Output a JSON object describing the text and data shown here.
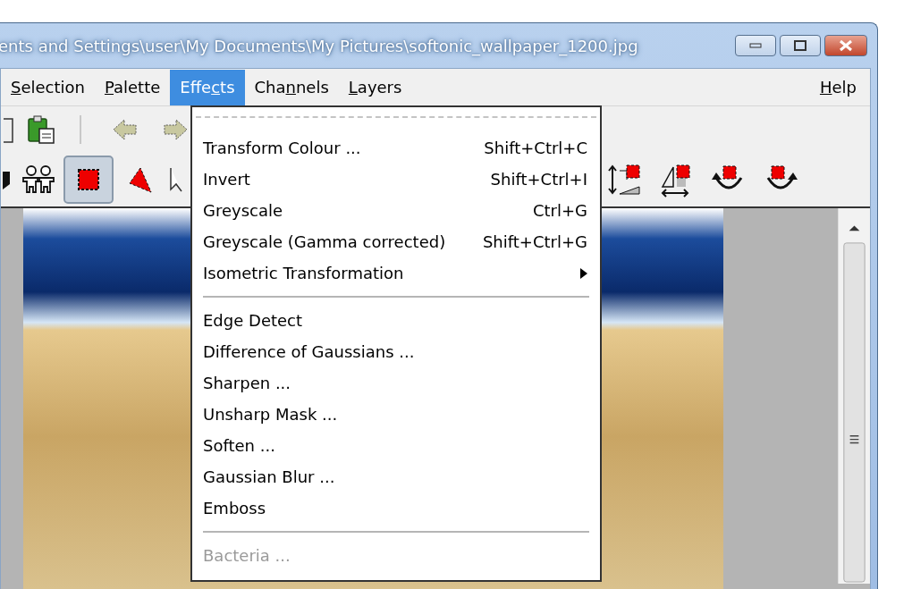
{
  "window": {
    "title": "ents and Settings\\user\\My Documents\\My Pictures\\softonic_wallpaper_1200.jpg"
  },
  "menu_bar": [
    {
      "label": {
        "key": "S",
        "after": "election"
      },
      "selected": false
    },
    {
      "label": {
        "key": "P",
        "after": "alette"
      },
      "selected": false
    },
    {
      "label": {
        "before": "Effe",
        "key": "c",
        "after": "ts"
      },
      "selected": true
    },
    {
      "label": {
        "before": "Cha",
        "key": "n",
        "after": "nels"
      },
      "selected": false
    },
    {
      "label": {
        "key": "L",
        "after": "ayers"
      },
      "selected": false
    }
  ],
  "help_menu": {
    "label": {
      "key": "H",
      "after": "elp"
    },
    "selected": false
  },
  "toolbar_top": [
    {
      "kind": "document"
    },
    {
      "kind": "paste"
    },
    {
      "kind": "separator"
    },
    {
      "kind": "back"
    },
    {
      "kind": "forward"
    }
  ],
  "toolbar_bottom": [
    {
      "kind": "shape",
      "selected": false
    },
    {
      "kind": "people",
      "selected": false
    },
    {
      "kind": "rect-select",
      "selected": true
    },
    {
      "kind": "lasso",
      "selected": false
    },
    {
      "kind": "pointer",
      "selected": false
    }
  ],
  "toolbar_right": [
    {
      "kind": "flip-vertical"
    },
    {
      "kind": "flip-horizontal"
    },
    {
      "kind": "rotate-left"
    },
    {
      "kind": "rotate-right"
    }
  ],
  "effects_menu": [
    {
      "kind": "tearoff"
    },
    {
      "kind": "item",
      "label": "Transform Colour ...",
      "shortcut": "Shift+Ctrl+C",
      "disabled": false
    },
    {
      "kind": "item",
      "label": "Invert",
      "shortcut": "Shift+Ctrl+I",
      "disabled": false
    },
    {
      "kind": "item",
      "label": "Greyscale",
      "shortcut": "Ctrl+G",
      "disabled": false
    },
    {
      "kind": "item",
      "label": "Greyscale (Gamma corrected)",
      "shortcut": "Shift+Ctrl+G",
      "disabled": false
    },
    {
      "kind": "submenu",
      "label": "Isometric Transformation",
      "disabled": false
    },
    {
      "kind": "separator"
    },
    {
      "kind": "item",
      "label": "Edge Detect",
      "disabled": false
    },
    {
      "kind": "item",
      "label": "Difference of Gaussians ...",
      "disabled": false
    },
    {
      "kind": "item",
      "label": "Sharpen ...",
      "disabled": false
    },
    {
      "kind": "item",
      "label": "Unsharp Mask ...",
      "disabled": false
    },
    {
      "kind": "item",
      "label": "Soften ...",
      "disabled": false
    },
    {
      "kind": "item",
      "label": "Gaussian Blur ...",
      "disabled": false
    },
    {
      "kind": "item",
      "label": "Emboss",
      "disabled": false
    },
    {
      "kind": "separator"
    },
    {
      "kind": "item",
      "label": "Bacteria ...",
      "disabled": true
    }
  ]
}
